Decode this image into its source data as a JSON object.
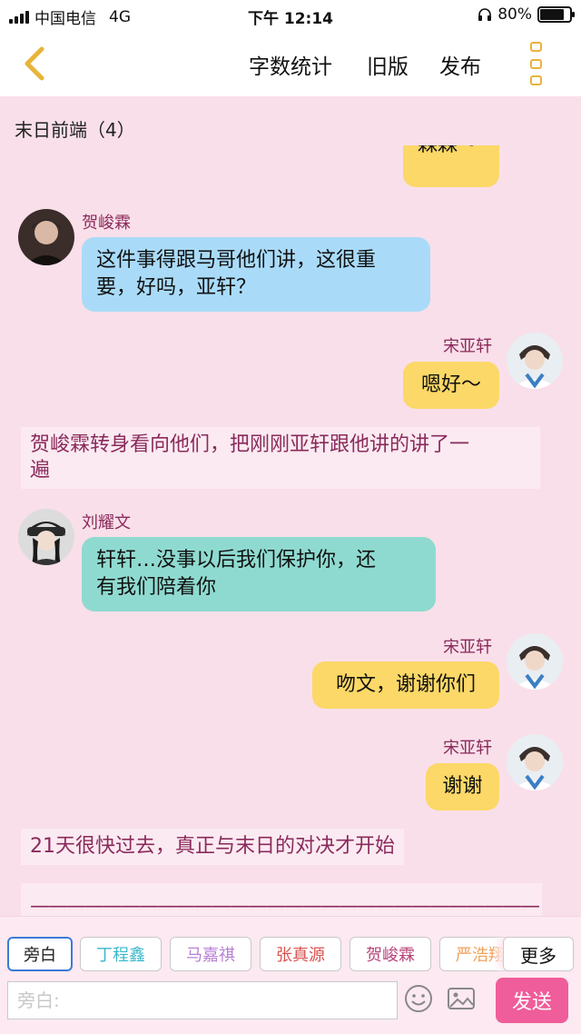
{
  "status_bar": {
    "carrier": "中国电信",
    "network": "4G",
    "time": "下午 12:14",
    "battery_percent": "80%",
    "battery_level": 0.8
  },
  "nav": {
    "back_icon": "chevron-left-icon",
    "word_count": "字数统计",
    "old_version": "旧版",
    "publish": "发布",
    "menu_icon": "menu-dots-icon"
  },
  "group_title": "末日前端（4）",
  "messages": [
    {
      "type": "partial",
      "side": "right",
      "text": "森森～",
      "color": "#fbd867"
    },
    {
      "type": "bubble",
      "side": "left",
      "name": "贺峻霖",
      "text_lines": [
        "这件事得跟马哥他们讲，这很重",
        "要，好吗，亚轩？"
      ],
      "color": "#a9dbf9"
    },
    {
      "type": "bubble",
      "side": "right",
      "name": "宋亚轩",
      "text_lines": [
        "嗯好～"
      ],
      "color": "#fbd867"
    },
    {
      "type": "narration",
      "text_lines": [
        "贺峻霖转身看向他们，把刚刚亚轩跟他讲的讲了一",
        "遍"
      ]
    },
    {
      "type": "bubble",
      "side": "left",
      "name": "刘耀文",
      "text_lines": [
        "轩轩…没事以后我们保护你，还",
        "有我们陪着你"
      ],
      "color": "#8fdad0"
    },
    {
      "type": "bubble",
      "side": "right",
      "name": "宋亚轩",
      "text_lines": [
        "吻文，谢谢你们"
      ],
      "color": "#fbd867"
    },
    {
      "type": "bubble",
      "side": "right",
      "name": "宋亚轩",
      "text_lines": [
        "谢谢"
      ],
      "color": "#fbd867"
    },
    {
      "type": "narration",
      "text_lines": [
        "21天很快过去，真正与末日的对决才开始"
      ]
    },
    {
      "type": "narration",
      "text_lines": [
        "————————————————————————————"
      ]
    }
  ],
  "characters": [
    {
      "label": "旁白",
      "color": "#222222",
      "active": true
    },
    {
      "label": "丁程鑫",
      "color": "#3bb8c9",
      "active": false
    },
    {
      "label": "马嘉祺",
      "color": "#b77fd6",
      "active": false
    },
    {
      "label": "张真源",
      "color": "#d9534f",
      "active": false
    },
    {
      "label": "贺峻霖",
      "color": "#b9417a",
      "active": false
    },
    {
      "label": "严浩翔",
      "color": "#f0a15a",
      "active": false
    }
  ],
  "more_label": "更多",
  "input": {
    "placeholder": "旁白:",
    "emoji_icon": "smiley-icon",
    "image_icon": "image-icon",
    "send_label": "发送"
  }
}
